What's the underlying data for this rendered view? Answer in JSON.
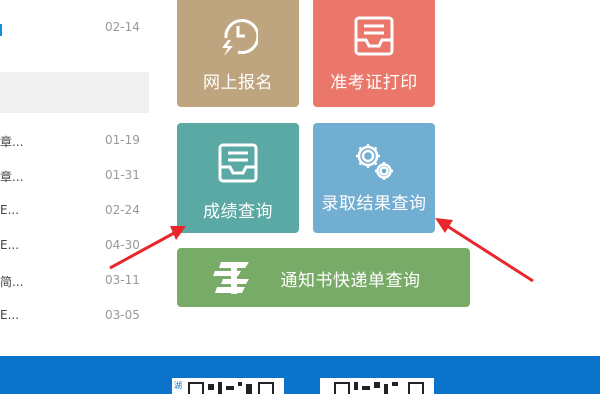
{
  "news": {
    "items": [
      {
        "title": "",
        "date": "02-14"
      },
      {
        "title": "章...",
        "date": "01-19"
      },
      {
        "title": "章...",
        "date": "01-31"
      },
      {
        "title": "E...",
        "date": "02-24"
      },
      {
        "title": "E...",
        "date": "04-30"
      },
      {
        "title": "简...",
        "date": "03-11"
      },
      {
        "title": "E...",
        "date": "03-05"
      }
    ]
  },
  "tiles": {
    "register": {
      "label": "网上报名",
      "icon": "clock-lightning-icon"
    },
    "admission_ticket": {
      "label": "准考证打印",
      "icon": "inbox-tray-icon"
    },
    "score": {
      "label": "成绩查询",
      "icon": "inbox-tray-icon"
    },
    "admission_result": {
      "label": "录取结果查询",
      "icon": "gears-icon"
    },
    "notice_tracking": {
      "label": "通知书快递单查询",
      "icon": "china-post-icon"
    }
  },
  "footer": {
    "qr_left_tag": "湖"
  },
  "colors": {
    "register": "#bfa57f",
    "admission_ticket": "#ea776a",
    "score": "#5ba9a4",
    "admission_result": "#72aed2",
    "notice_tracking": "#79ab68",
    "footer": "#0b73c9",
    "arrow": "#e8262c"
  }
}
